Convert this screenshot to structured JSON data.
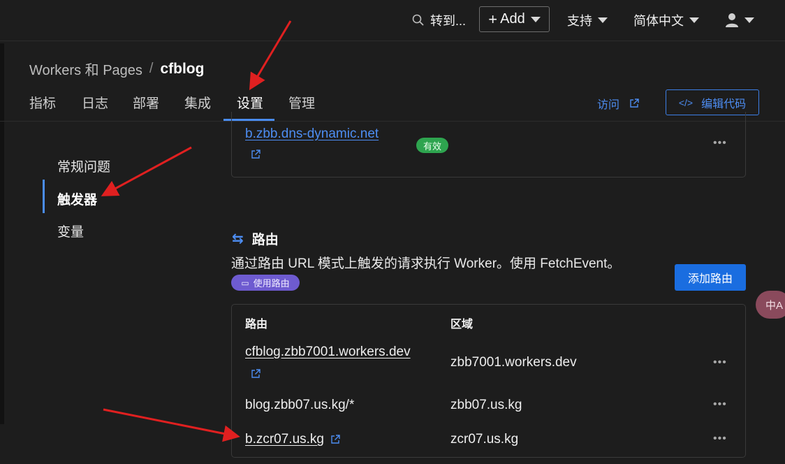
{
  "topbar": {
    "search_label": "转到...",
    "add_label": "Add",
    "support_label": "支持",
    "language_label": "简体中文",
    "icons": [
      "search-icon",
      "plus-icon",
      "user-icon",
      "chevron-down-icon"
    ]
  },
  "breadcrumb": {
    "parent": "Workers 和 Pages",
    "separator": "/",
    "current": "cfblog"
  },
  "tabs": [
    {
      "label": "指标",
      "active": false
    },
    {
      "label": "日志",
      "active": false
    },
    {
      "label": "部署",
      "active": false
    },
    {
      "label": "集成",
      "active": false
    },
    {
      "label": "设置",
      "active": true
    },
    {
      "label": "管理",
      "active": false
    }
  ],
  "actions": {
    "visit_label": "访问",
    "edit_code_label": "编辑代码"
  },
  "sidebar": {
    "items": [
      {
        "label": "常规问题",
        "active": false
      },
      {
        "label": "触发器",
        "active": true
      },
      {
        "label": "变量",
        "active": false
      }
    ]
  },
  "custom_domains": {
    "rows": [
      {
        "domain": "b.zbb.dns-dynamic.net",
        "status": "有效"
      }
    ]
  },
  "routes": {
    "title": "路由",
    "description": "通过路由 URL 模式上触发的请求执行 Worker。使用 FetchEvent。",
    "docs_badge": "使用路由",
    "add_button": "添加路由",
    "columns": [
      "路由",
      "区域"
    ],
    "rows": [
      {
        "route": "cfblog.zbb7001.workers.dev",
        "zone": "zbb7001.workers.dev",
        "link": true
      },
      {
        "route": "blog.zbb07.us.kg/*",
        "zone": "zbb07.us.kg",
        "link": false
      },
      {
        "route": "b.zcr07.us.kg",
        "zone": "zcr07.us.kg",
        "link": true
      }
    ]
  },
  "floating": {
    "translate_label": "中A"
  },
  "colors": {
    "background": "#1d1d1d",
    "accent": "#4d8df2",
    "primary_button": "#1a6de0",
    "status_ok": "#2ea44f",
    "docs_badge": "#6e5bd0",
    "annotation_arrow": "#e02020"
  }
}
